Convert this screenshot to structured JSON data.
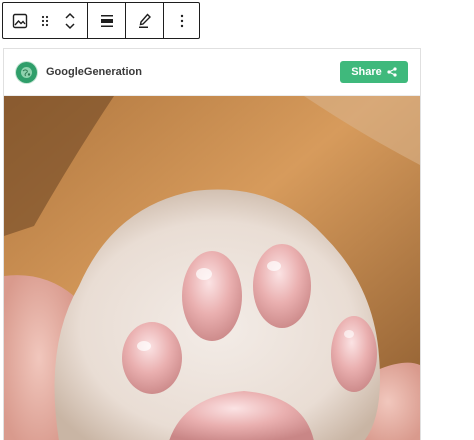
{
  "toolbar": {
    "buttons": [
      {
        "name": "image-icon"
      },
      {
        "name": "drag-handle-icon"
      },
      {
        "name": "move-up-down-icon"
      },
      {
        "name": "align-icon"
      },
      {
        "name": "edit-pencil-icon"
      },
      {
        "name": "more-options-icon"
      }
    ]
  },
  "card": {
    "site_name": "GoogleGeneration",
    "share_label": "Share",
    "share_color": "#3fb97c",
    "avatar_color": "#2f9e6a",
    "image": {
      "subject": "close-up of a white cat paw with pink toe beans",
      "background_colors": [
        "#c98f56",
        "#8a5a2e",
        "#f4e9e2"
      ]
    }
  }
}
